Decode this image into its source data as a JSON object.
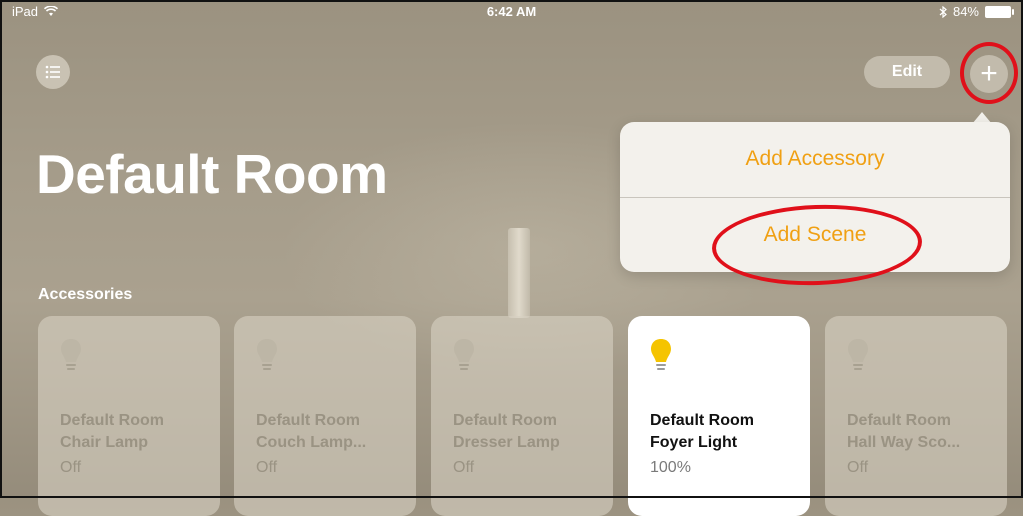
{
  "status_bar": {
    "device": "iPad",
    "time": "6:42 AM",
    "battery": "84%"
  },
  "header": {
    "edit_label": "Edit",
    "add_label": "+"
  },
  "page_title": "Default Room",
  "popover": {
    "items": [
      {
        "label": "Add Accessory"
      },
      {
        "label": "Add Scene"
      }
    ]
  },
  "section_label": "Accessories",
  "colors": {
    "accent": "#f0a013",
    "annotation": "#e0101a",
    "bulb_on": "#f5c400",
    "bulb_off": "#bdb6a6"
  },
  "accessories": [
    {
      "line1": "Default Room",
      "line2": "Chair Lamp",
      "state": "Off",
      "on": false
    },
    {
      "line1": "Default Room",
      "line2": "Couch Lamp...",
      "state": "Off",
      "on": false
    },
    {
      "line1": "Default Room",
      "line2": "Dresser Lamp",
      "state": "Off",
      "on": false
    },
    {
      "line1": "Default Room",
      "line2": "Foyer Light",
      "state": "100%",
      "on": true
    },
    {
      "line1": "Default Room",
      "line2": "Hall Way Sco...",
      "state": "Off",
      "on": false
    }
  ]
}
